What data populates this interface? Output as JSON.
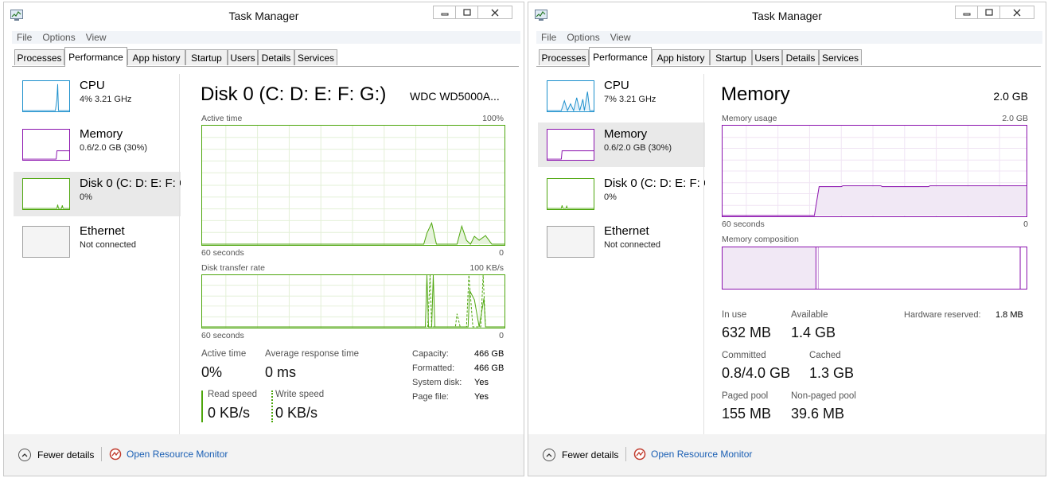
{
  "windows": [
    {
      "title": "Task Manager",
      "menu": [
        "File",
        "Options",
        "View"
      ],
      "tabs": [
        "Processes",
        "Performance",
        "App history",
        "Startup",
        "Users",
        "Details",
        "Services"
      ],
      "active_tab": "Performance",
      "sidebar": [
        {
          "title": "CPU",
          "sub": "4% 3.21 GHz"
        },
        {
          "title": "Memory",
          "sub": "0.6/2.0 GB (30%)"
        },
        {
          "title": "Disk 0 (C: D: E: F: G",
          "sub": "0%"
        },
        {
          "title": "Ethernet",
          "sub": "Not connected"
        }
      ],
      "selected_item": "Disk 0",
      "main": {
        "heading": "Disk 0 (C: D: E: F: G:)",
        "model": "WDC WD5000A...",
        "graph1_label": "Active time",
        "graph1_max": "100%",
        "graph1_time": "60 seconds",
        "graph1_zero": "0",
        "graph2_label": "Disk transfer rate",
        "graph2_max": "100 KB/s",
        "graph2_time": "60 seconds",
        "graph2_zero": "0",
        "stats": {
          "active_time_label": "Active time",
          "active_time_value": "0%",
          "avg_resp_label": "Average response time",
          "avg_resp_value": "0 ms",
          "read_label": "Read speed",
          "read_value": "0 KB/s",
          "write_label": "Write speed",
          "write_value": "0 KB/s"
        },
        "info": [
          {
            "label": "Capacity:",
            "value": "466 GB"
          },
          {
            "label": "Formatted:",
            "value": "466 GB"
          },
          {
            "label": "System disk:",
            "value": "Yes"
          },
          {
            "label": "Page file:",
            "value": "Yes"
          }
        ]
      },
      "footer": {
        "fewer": "Fewer details",
        "resmon": "Open Resource Monitor"
      }
    },
    {
      "title": "Task Manager",
      "menu": [
        "File",
        "Options",
        "View"
      ],
      "tabs": [
        "Processes",
        "Performance",
        "App history",
        "Startup",
        "Users",
        "Details",
        "Services"
      ],
      "active_tab": "Performance",
      "sidebar": [
        {
          "title": "CPU",
          "sub": "7% 3.21 GHz"
        },
        {
          "title": "Memory",
          "sub": "0.6/2.0 GB (30%)"
        },
        {
          "title": "Disk 0 (C: D: E: F: G",
          "sub": "0%"
        },
        {
          "title": "Ethernet",
          "sub": "Not connected"
        }
      ],
      "selected_item": "Memory",
      "main": {
        "heading": "Memory",
        "total": "2.0 GB",
        "graph1_label": "Memory usage",
        "graph1_max": "2.0 GB",
        "graph1_time": "60 seconds",
        "graph1_zero": "0",
        "composition_label": "Memory composition",
        "stats": {
          "in_use_label": "In use",
          "in_use_value": "632 MB",
          "available_label": "Available",
          "available_value": "1.4 GB",
          "hw_label": "Hardware reserved:",
          "hw_value": "1.8 MB",
          "committed_label": "Committed",
          "committed_value": "0.8/4.0 GB",
          "cached_label": "Cached",
          "cached_value": "1.3 GB",
          "paged_label": "Paged pool",
          "paged_value": "155 MB",
          "nonpaged_label": "Non-paged pool",
          "nonpaged_value": "39.6 MB"
        }
      },
      "footer": {
        "fewer": "Fewer details",
        "resmon": "Open Resource Monitor"
      }
    }
  ],
  "colors": {
    "cpu": "#1b8fcc",
    "memory": "#8b12ae",
    "disk": "#4da60c",
    "ethernet": "#a0a0a0",
    "link": "#1a5fb4"
  }
}
